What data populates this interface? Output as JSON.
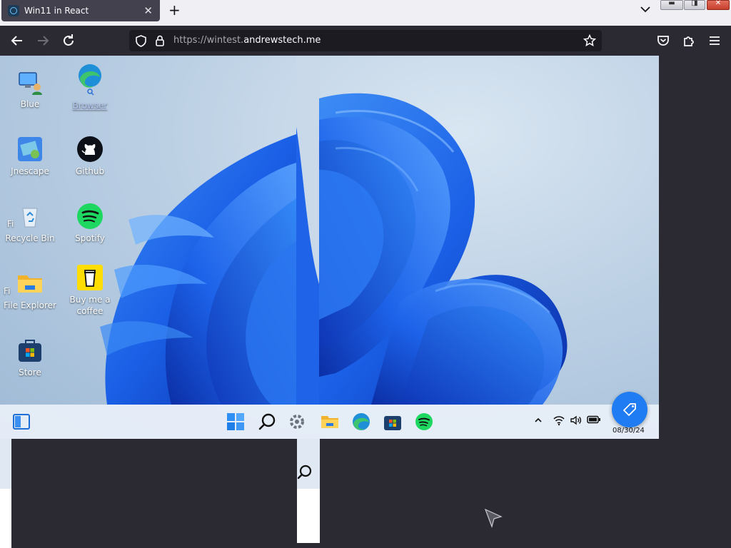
{
  "browser": {
    "tab_title": "Win11 in React",
    "close_glyph": "✕",
    "new_tab_glyph": "+",
    "url_scheme": "https://wintest.",
    "url_host": "andrewstech.me",
    "min_glyph": "▬",
    "max_glyph": "◨",
    "close_window_glyph": "✕"
  },
  "desktop": {
    "icons": [
      {
        "label": "Blue",
        "icon": "computer-user-icon"
      },
      {
        "label": "Browser",
        "icon": "edge-search-icon"
      },
      {
        "label": "Jnescape",
        "icon": "unescape-icon"
      },
      {
        "label": "Github",
        "icon": "github-icon"
      },
      {
        "label": "Recycle Bin",
        "icon": "recycle-bin-icon"
      },
      {
        "label": "Spotify",
        "icon": "spotify-icon"
      },
      {
        "label": "File Explorer",
        "icon": "folder-icon"
      },
      {
        "label": "Buy me a coffee",
        "icon": "coffee-cup-icon"
      },
      {
        "label": "Store",
        "icon": "store-icon"
      }
    ],
    "stray_left_labels": [
      "Fi",
      "Fi"
    ]
  },
  "taskbar": {
    "clock": "08/30/24",
    "apps": [
      "widgets-icon",
      "start-icon",
      "search-icon",
      "settings-icon",
      "folder-icon",
      "edge-icon",
      "store-icon",
      "spotify-icon"
    ],
    "tray": [
      "chevron-up-icon",
      "wifi-icon",
      "volume-icon",
      "battery-icon"
    ]
  },
  "colors": {
    "accent": "#1f7cf2",
    "browser_dark": "#2b2a33",
    "tab_bar": "#f0f0f4"
  }
}
